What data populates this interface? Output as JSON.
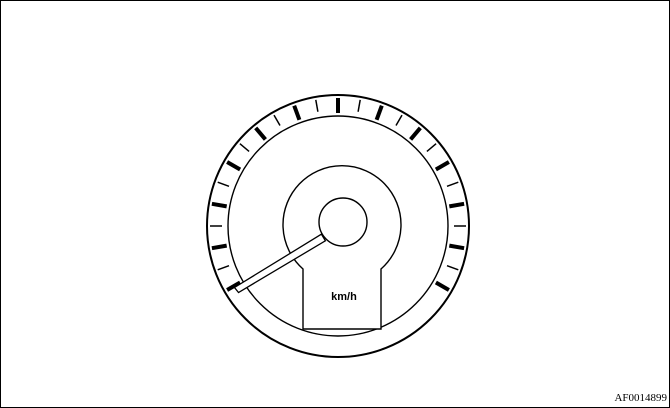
{
  "figure": {
    "unit_label": "km/h",
    "code": "AF0014899"
  },
  "gauge": {
    "needle_pointer": "lower-left",
    "ink_color": "#000000",
    "paper_color": "#ffffff"
  }
}
